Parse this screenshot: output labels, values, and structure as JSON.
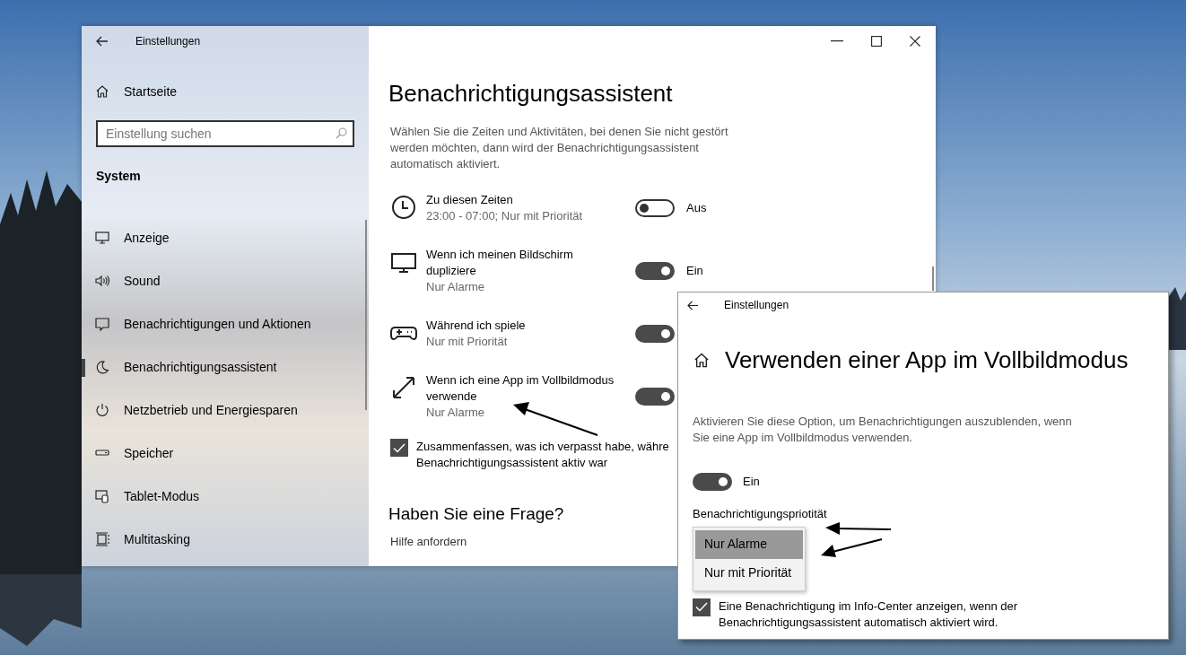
{
  "main_window": {
    "title": "Einstellungen",
    "sidebar": {
      "home": "Startseite",
      "search": {
        "placeholder": "Einstellung suchen"
      },
      "section": "System",
      "items": [
        {
          "label": "Anzeige",
          "selected": false
        },
        {
          "label": "Sound",
          "selected": false
        },
        {
          "label": "Benachrichtigungen und Aktionen",
          "selected": false
        },
        {
          "label": "Benachrichtigungsassistent",
          "selected": true
        },
        {
          "label": "Netzbetrieb und Energiesparen",
          "selected": false
        },
        {
          "label": "Speicher",
          "selected": false
        },
        {
          "label": "Tablet-Modus",
          "selected": false
        },
        {
          "label": "Multitasking",
          "selected": false
        }
      ]
    },
    "content": {
      "heading": "Benachrichtigungsassistent",
      "description": "Wählen Sie die Zeiten und Aktivitäten, bei denen Sie nicht gestört werden möchten, dann wird der Benachrichtigungsassistent automatisch aktiviert.",
      "rules": [
        {
          "title": "Zu diesen Zeiten",
          "subtitle": "23:00 - 07:00; Nur mit Priorität",
          "on": false,
          "state_label": "Aus"
        },
        {
          "title": "Wenn ich meinen Bildschirm dupliziere",
          "subtitle": "Nur Alarme",
          "on": true,
          "state_label": "Ein"
        },
        {
          "title": "Während ich spiele",
          "subtitle": "Nur mit Priorität",
          "on": true
        },
        {
          "title": "Wenn ich eine App im Vollbildmodus verwende",
          "subtitle": "Nur Alarme",
          "on": true
        }
      ],
      "summary_checkbox": {
        "checked": true,
        "lines": [
          "Zusammenfassen, was ich verpasst habe, währe",
          "Benachrichtigungsassistent aktiv war"
        ]
      },
      "help_heading": "Haben Sie eine Frage?",
      "help_link": "Hilfe anfordern"
    }
  },
  "detail_window": {
    "title": "Einstellungen",
    "heading": "Verwenden einer App im Vollbildmodus",
    "description": "Aktivieren Sie diese Option, um Benachrichtigungen auszublenden, wenn Sie eine App im Vollbildmodus verwenden.",
    "toggle": {
      "on": true,
      "state_label": "Ein"
    },
    "priority_label": "Benachrichtigungspriotität",
    "priority_options": [
      {
        "label": "Nur Alarme",
        "selected": true
      },
      {
        "label": "Nur mit Priorität",
        "selected": false
      }
    ],
    "notify_checkbox": {
      "checked": true,
      "text": "Eine Benachrichtigung im Info-Center anzeigen, wenn der Benachrichtigungsassistent automatisch aktiviert wird."
    }
  }
}
